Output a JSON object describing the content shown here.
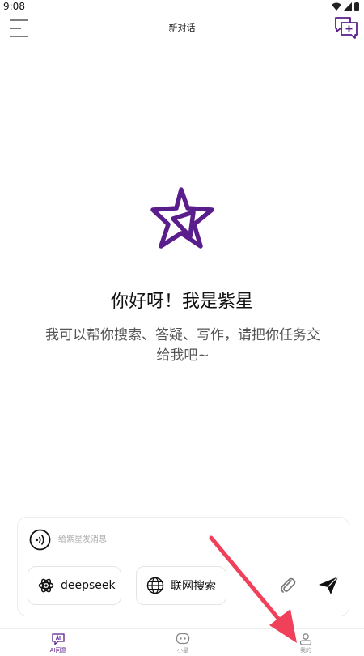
{
  "status_bar": {
    "time": "9:08"
  },
  "header": {
    "title": "新对话"
  },
  "welcome": {
    "greeting": "你好呀！我是紫星",
    "subtitle": "我可以帮你搜索、答疑、写作，请把你任务交给我吧~"
  },
  "composer": {
    "placeholder": "给紫星发消息",
    "chips": [
      {
        "label": "deepseek",
        "icon": "atom-icon"
      },
      {
        "label": "联网搜索",
        "icon": "globe-icon"
      }
    ]
  },
  "bottom_nav": {
    "items": [
      {
        "label": "AI问意",
        "icon": "ai-icon",
        "active": true
      },
      {
        "label": "小星",
        "icon": "xiaoxing-icon",
        "active": false
      },
      {
        "label": "我的",
        "icon": "profile-icon",
        "active": false
      }
    ]
  },
  "colors": {
    "brand": "#5a1e8c",
    "annotation_arrow": "#f0405a"
  }
}
